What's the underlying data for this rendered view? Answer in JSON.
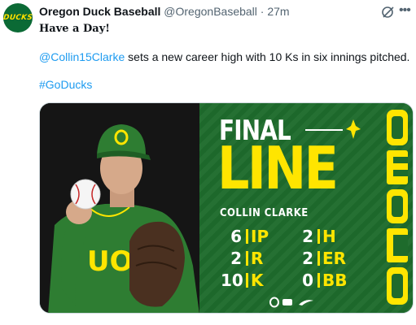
{
  "tweet": {
    "display_name": "Oregon Duck Baseball",
    "handle": "@OregonBaseball",
    "separator": "·",
    "time": "27m",
    "avatar_text": "DUCKS",
    "line1": "Have a Day!",
    "mention": "@Collin15Clarke",
    "line2_rest": " sets a new career high with 10 Ks in six innings pitched.",
    "hashtag": "#GoDucks",
    "icons": [
      "grok-icon",
      "more-icon"
    ]
  },
  "graphic": {
    "final_label": "FINAL",
    "line_label": "LINE",
    "player_name": "COLLIN CLARKE",
    "brand_text": "Oregon",
    "jersey_text": "UO",
    "colors": {
      "green": "#1e6b2c",
      "yellow": "#ffe500",
      "white": "#ffffff"
    },
    "stats": [
      {
        "value": "6",
        "label": "IP"
      },
      {
        "value": "2",
        "label": "H"
      },
      {
        "value": "2",
        "label": "R"
      },
      {
        "value": "2",
        "label": "ER"
      },
      {
        "value": "10",
        "label": "K"
      },
      {
        "value": "0",
        "label": "BB"
      }
    ]
  }
}
